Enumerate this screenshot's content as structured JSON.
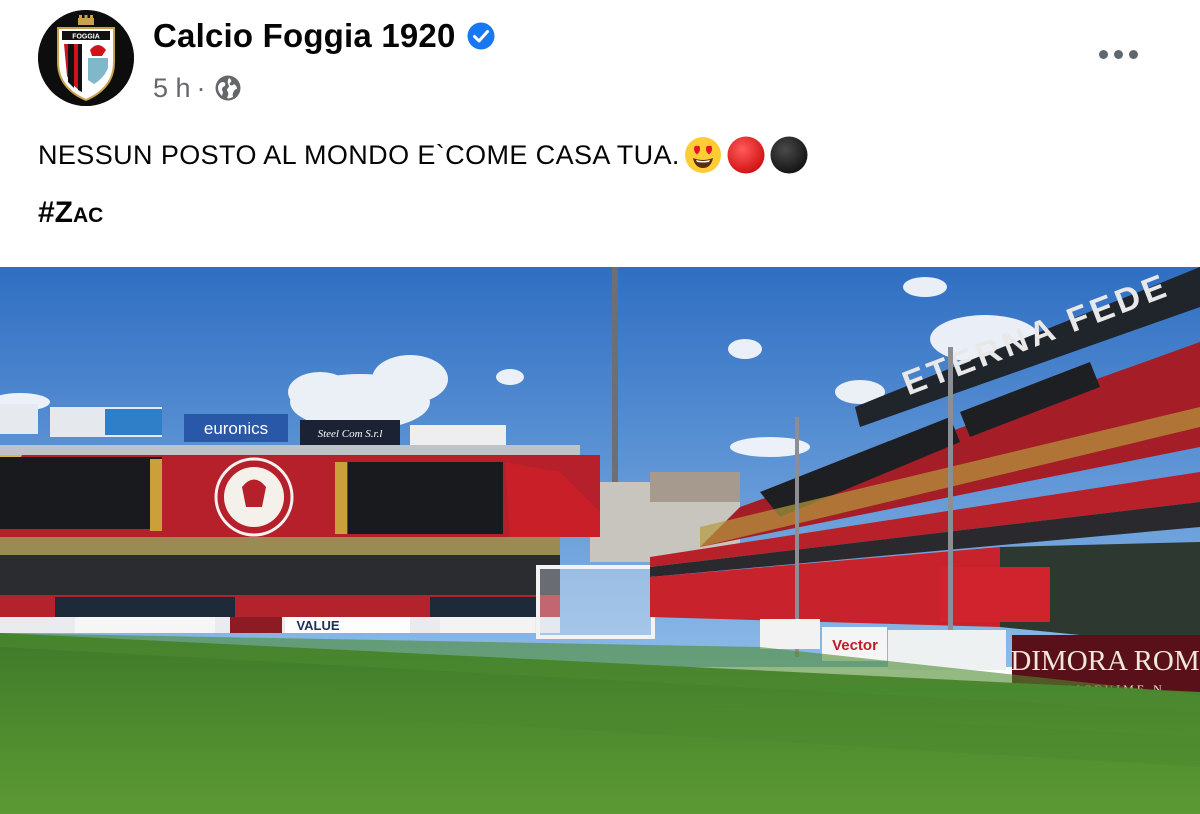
{
  "post": {
    "author": "Calcio Foggia 1920",
    "verified": true,
    "timestamp": "5 h",
    "separator": "·",
    "audience_icon": "globe-icon",
    "more_icon": "more-options-icon",
    "text": "NESSUN POSTO AL MONDO E`COME CASA TUA.",
    "emojis": [
      "heart-eyes-emoji",
      "red-circle-emoji",
      "black-circle-emoji"
    ],
    "hashtag_prefix": "#Z",
    "hashtag_rest": "ac"
  },
  "logo": {
    "brand_text": "FOGGIA",
    "colors": {
      "red": "#d0121b",
      "black": "#111111",
      "gold": "#c9a14a"
    }
  },
  "media": {
    "type": "video-frame",
    "description_icon": "stadium-photo",
    "banners": {
      "euronics": "euronics",
      "steel_com": "Steel Com S.r.l",
      "eterna_fede": "ETERNA FEDE",
      "dimora": "DIMORA ROM",
      "ricevimenti": "RICEVIME N",
      "value": "VALUE",
      "vector": "Vector"
    }
  },
  "colors": {
    "accent_blue": "#1877f2",
    "secondary_text": "#65676b",
    "primary_text": "#050505"
  }
}
